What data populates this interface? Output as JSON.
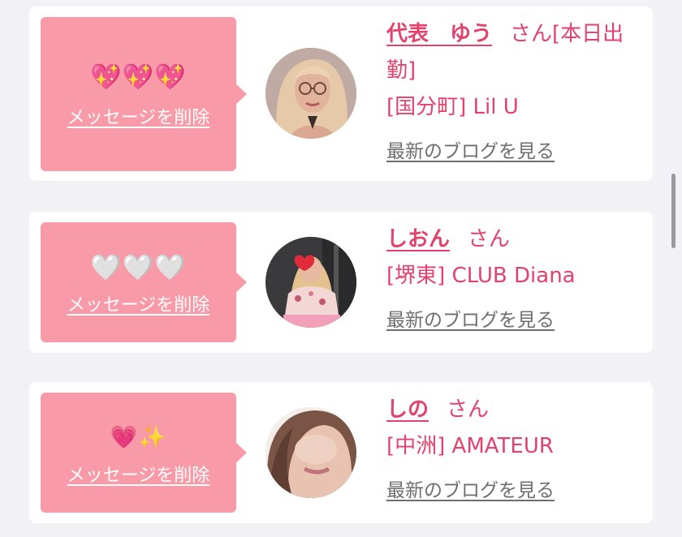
{
  "colors": {
    "page_bg": "#f2f1f5",
    "card_bg": "#ffffff",
    "bubble_bg": "#f99aa8",
    "accent_text": "#e2426c",
    "link_gray": "#6e6e6e"
  },
  "messages": [
    {
      "emoji": "💖💖💖",
      "delete_label": "メッセージを削除",
      "name": "代表　ゆう",
      "suffix": "さん[本日出勤]",
      "shop": "[国分町] Lil U",
      "blog_link": "最新のブログを見る",
      "avatar_icon": "profile-photo-woman-glasses"
    },
    {
      "emoji": "🤍🤍🤍",
      "delete_label": "メッセージを削除",
      "name": "しおん",
      "suffix": "さん",
      "shop": "[堺東] CLUB Diana",
      "blog_link": "最新のブログを見る",
      "avatar_icon": "profile-photo-woman-heart-sticker"
    },
    {
      "emoji": "💗✨",
      "delete_label": "メッセージを削除",
      "name": "しの",
      "suffix": "さん",
      "shop": "[中洲] AMATEUR",
      "blog_link": "最新のブログを見る",
      "avatar_icon": "profile-photo-woman-closeup"
    }
  ]
}
